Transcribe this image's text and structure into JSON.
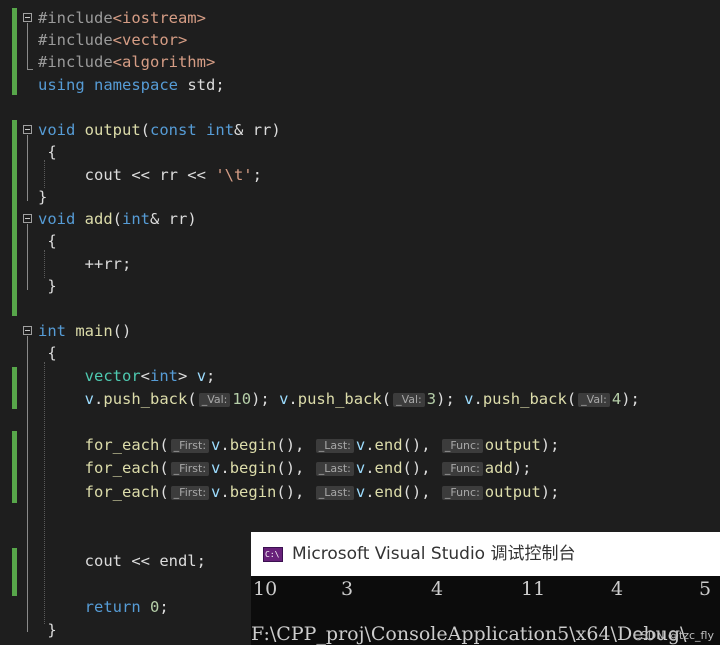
{
  "editor": {
    "lines": [
      {
        "tokens": [
          [
            "pp",
            "#include"
          ],
          [
            "inc",
            "<iostream>"
          ]
        ]
      },
      {
        "tokens": [
          [
            "pp",
            "#include"
          ],
          [
            "inc",
            "<vector>"
          ]
        ]
      },
      {
        "tokens": [
          [
            "pp",
            "#include"
          ],
          [
            "inc",
            "<algorithm>"
          ]
        ]
      },
      {
        "tokens": [
          [
            "kw",
            "using"
          ],
          [
            "t",
            " "
          ],
          [
            "kw",
            "namespace"
          ],
          [
            "t",
            " std;"
          ]
        ]
      },
      {
        "tokens": []
      },
      {
        "tokens": [
          [
            "kw",
            "void"
          ],
          [
            "t",
            " "
          ],
          [
            "fn",
            "output"
          ],
          [
            "t",
            "("
          ],
          [
            "kw",
            "const"
          ],
          [
            "t",
            " "
          ],
          [
            "kw",
            "int"
          ],
          [
            "t",
            "& rr)"
          ]
        ]
      },
      {
        "tokens": [
          [
            "t",
            " {"
          ]
        ]
      },
      {
        "tokens": [
          [
            "t",
            "     cout << rr << "
          ],
          [
            "str",
            "'\\t'"
          ],
          [
            "t",
            ";"
          ]
        ]
      },
      {
        "tokens": [
          [
            "t",
            "}"
          ]
        ]
      },
      {
        "tokens": [
          [
            "kw",
            "void"
          ],
          [
            "t",
            " "
          ],
          [
            "fn",
            "add"
          ],
          [
            "t",
            "("
          ],
          [
            "kw",
            "int"
          ],
          [
            "t",
            "& rr)"
          ]
        ]
      },
      {
        "tokens": [
          [
            "t",
            " {"
          ]
        ]
      },
      {
        "tokens": [
          [
            "t",
            "     ++rr;"
          ]
        ]
      },
      {
        "tokens": [
          [
            "t",
            " }"
          ]
        ]
      },
      {
        "tokens": []
      },
      {
        "tokens": [
          [
            "kw",
            "int"
          ],
          [
            "t",
            " "
          ],
          [
            "fn",
            "main"
          ],
          [
            "t",
            "()"
          ]
        ]
      },
      {
        "tokens": [
          [
            "t",
            " {"
          ]
        ]
      },
      {
        "tokens": [
          [
            "t",
            "     "
          ],
          [
            "type",
            "vector"
          ],
          [
            "t",
            "<"
          ],
          [
            "kw",
            "int"
          ],
          [
            "t",
            "> "
          ],
          [
            "var",
            "v"
          ],
          [
            "t",
            ";"
          ]
        ]
      },
      {
        "tokens": [
          [
            "t",
            "     "
          ],
          [
            "var",
            "v"
          ],
          [
            "t",
            "."
          ],
          [
            "fn",
            "push_back"
          ],
          [
            "t",
            "("
          ],
          [
            "hint",
            "_Val:"
          ],
          [
            "num",
            "10"
          ],
          [
            "t",
            "); "
          ],
          [
            "var",
            "v"
          ],
          [
            "t",
            "."
          ],
          [
            "fn",
            "push_back"
          ],
          [
            "t",
            "("
          ],
          [
            "hint",
            "_Val:"
          ],
          [
            "num",
            "3"
          ],
          [
            "t",
            "); "
          ],
          [
            "var",
            "v"
          ],
          [
            "t",
            "."
          ],
          [
            "fn",
            "push_back"
          ],
          [
            "t",
            "("
          ],
          [
            "hint",
            "_Val:"
          ],
          [
            "num",
            "4"
          ],
          [
            "t",
            ");"
          ]
        ]
      },
      {
        "tokens": []
      },
      {
        "tokens": [
          [
            "t",
            "     "
          ],
          [
            "fn",
            "for_each"
          ],
          [
            "t",
            "("
          ],
          [
            "hint",
            "_First:"
          ],
          [
            "var",
            "v"
          ],
          [
            "t",
            "."
          ],
          [
            "fn",
            "begin"
          ],
          [
            "t",
            "(), "
          ],
          [
            "hint",
            "_Last:"
          ],
          [
            "var",
            "v"
          ],
          [
            "t",
            "."
          ],
          [
            "fn",
            "end"
          ],
          [
            "t",
            "(), "
          ],
          [
            "hint",
            "_Func:"
          ],
          [
            "fn",
            "output"
          ],
          [
            "t",
            ");"
          ]
        ]
      },
      {
        "tokens": [
          [
            "t",
            "     "
          ],
          [
            "fn",
            "for_each"
          ],
          [
            "t",
            "("
          ],
          [
            "hint",
            "_First:"
          ],
          [
            "var",
            "v"
          ],
          [
            "t",
            "."
          ],
          [
            "fn",
            "begin"
          ],
          [
            "t",
            "(), "
          ],
          [
            "hint",
            "_Last:"
          ],
          [
            "var",
            "v"
          ],
          [
            "t",
            "."
          ],
          [
            "fn",
            "end"
          ],
          [
            "t",
            "(), "
          ],
          [
            "hint",
            "_Func:"
          ],
          [
            "fn",
            "add"
          ],
          [
            "t",
            ");"
          ]
        ]
      },
      {
        "tokens": [
          [
            "t",
            "     "
          ],
          [
            "fn",
            "for_each"
          ],
          [
            "t",
            "("
          ],
          [
            "hint",
            "_First:"
          ],
          [
            "var",
            "v"
          ],
          [
            "t",
            "."
          ],
          [
            "fn",
            "begin"
          ],
          [
            "t",
            "(), "
          ],
          [
            "hint",
            "_Last:"
          ],
          [
            "var",
            "v"
          ],
          [
            "t",
            "."
          ],
          [
            "fn",
            "end"
          ],
          [
            "t",
            "(), "
          ],
          [
            "hint",
            "_Func:"
          ],
          [
            "fn",
            "output"
          ],
          [
            "t",
            ");"
          ]
        ]
      },
      {
        "tokens": []
      },
      {
        "tokens": []
      },
      {
        "tokens": [
          [
            "t",
            "     cout << endl;"
          ]
        ]
      },
      {
        "tokens": []
      },
      {
        "tokens": [
          [
            "t",
            "     "
          ],
          [
            "kw",
            "return"
          ],
          [
            "t",
            " "
          ],
          [
            "num",
            "0"
          ],
          [
            "t",
            ";"
          ]
        ]
      },
      {
        "tokens": [
          [
            "t",
            " }"
          ]
        ]
      }
    ]
  },
  "console": {
    "icon_label": "C:\\",
    "title": "Microsoft Visual Studio 调试控制台",
    "output_values": [
      "10",
      "3",
      "4",
      "11",
      "4",
      "5"
    ],
    "path_line": "F:\\CPP_proj\\ConsoleApplication5\\x64\\Debug\\"
  },
  "watermark": "CSDN @tzc_fly",
  "colors": {
    "background": "#1e1e1e",
    "keyword": "#569cd6",
    "function": "#dcdcaa",
    "type": "#4ec9b0",
    "string": "#d69d85",
    "number": "#b5cea8",
    "change_bar": "#57a64a"
  }
}
